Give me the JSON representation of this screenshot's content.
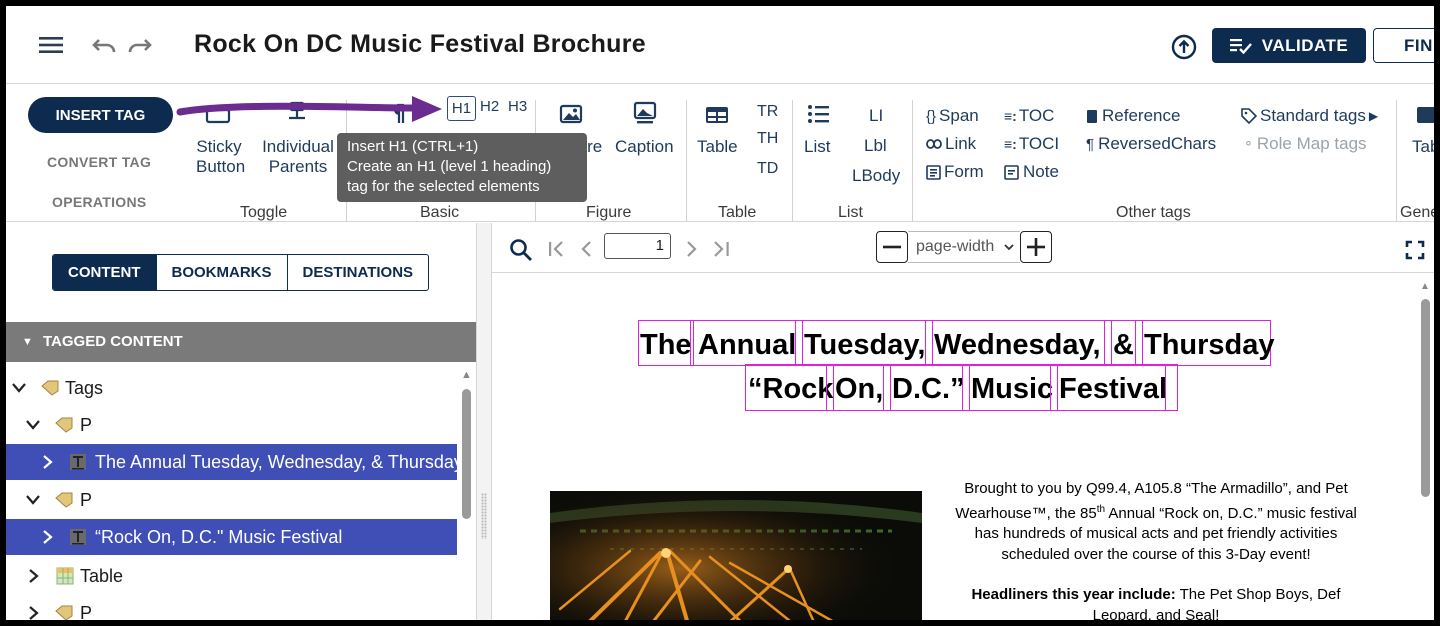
{
  "header": {
    "title": "Rock On DC Music Festival Brochure",
    "validate_label": "VALIDATE",
    "find_label": "FIND"
  },
  "ribbon": {
    "insert_tag_label": "INSERT TAG",
    "convert_tag_label": "CONVERT TAG",
    "operations_label": "OPERATIONS",
    "toggle": {
      "sticky_1": "Sticky",
      "sticky_2": "Button",
      "parents_1": "Individual",
      "parents_2": "Parents",
      "group": "Toggle"
    },
    "basic": {
      "h1": "H1",
      "h2": "H2",
      "h3": "H3",
      "group": "Basic"
    },
    "tooltip": {
      "line1": "Insert H1 (CTRL+1)",
      "line2": "Create an H1 (level 1 heading)",
      "line3": "tag for the selected elements"
    },
    "figure": {
      "figure_label": "Figure",
      "caption_label": "Caption",
      "group": "Figure"
    },
    "table": {
      "table_label": "Table",
      "tr": "TR",
      "th": "TH",
      "td": "TD",
      "group": "Table"
    },
    "list": {
      "list_label": "List",
      "li": "LI",
      "lbl": "Lbl",
      "lbody": "LBody",
      "group": "List"
    },
    "other": {
      "span": "Span",
      "link": "Link",
      "form": "Form",
      "toc": "TOC",
      "toci": "TOCI",
      "note": "Note",
      "reference": "Reference",
      "reversedchars": "ReversedChars",
      "standard_tags": "Standard tags",
      "role_map_tags": "Role Map tags",
      "group": "Other tags"
    },
    "generic": {
      "tab_label": "Tab",
      "group": "Gene"
    }
  },
  "left_panel": {
    "tabs": [
      "CONTENT",
      "BOOKMARKS",
      "DESTINATIONS"
    ],
    "section_title": "TAGGED CONTENT",
    "tree": [
      {
        "label": "Tags"
      },
      {
        "label": "P"
      },
      {
        "label": "The  Annual  Tuesday,  Wednesday,  &  Thursday"
      },
      {
        "label": "P"
      },
      {
        "label": "“Rock  On,  D.C.\"  Music  Festival"
      },
      {
        "label": "Table"
      },
      {
        "label": "P"
      }
    ]
  },
  "viewer": {
    "page_number": "1",
    "zoom": "page-width",
    "heading_line1_words": [
      "The",
      "Annual",
      "Tuesday,",
      "Wednesday,",
      "&",
      "Thursday"
    ],
    "heading_line2_words": [
      "“Rock",
      "On,",
      "D.C.”",
      "Music",
      "Festival"
    ],
    "intro_pre": "Brought to you by Q99.4, A105.8 “The Armadillo”, and Pet Wearhouse™, the 85",
    "intro_sup": "th",
    "intro_post": " Annual “Rock on, D.C.” music festival has hundreds of musical acts and pet friendly activities scheduled over the course of this 3-Day event!",
    "headliners_label": "Headliners this year include:",
    "headliners_text": " The Pet Shop Boys, Def Leopard, and Seal!"
  },
  "colors": {
    "navy": "#0d2a4f",
    "selection": "#3f4fb5",
    "annotation_arrow": "#6b2b8f",
    "tag_box": "#e020e0"
  }
}
